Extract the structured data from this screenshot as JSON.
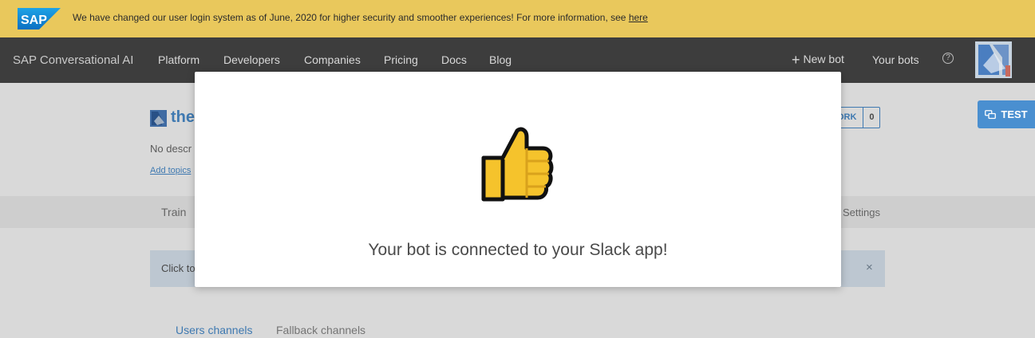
{
  "banner": {
    "logo_text": "SAP",
    "message": "We have changed our user login system as of June, 2020 for higher security and smoother experiences! For more information, see ",
    "link_label": "here"
  },
  "navbar": {
    "brand": "SAP Conversational AI",
    "items": [
      "Platform",
      "Developers",
      "Companies",
      "Pricing",
      "Docs",
      "Blog"
    ],
    "new_bot": "New bot",
    "your_bots": "Your bots",
    "help_symbol": "?"
  },
  "bot": {
    "name": "the",
    "description": "No descr",
    "add_topics": "Add topics",
    "fork_label": "ORK",
    "fork_count": "0"
  },
  "tabs": {
    "train": "Train",
    "settings": "Settings"
  },
  "info_bar": {
    "text": "Click to",
    "close_symbol": "×"
  },
  "channels": {
    "users": "Users channels",
    "fallback": "Fallback channels"
  },
  "test_button": {
    "label": "TEST"
  },
  "modal": {
    "icon": "thumbs-up-icon",
    "message": "Your bot is connected to your Slack app!"
  },
  "colors": {
    "banner": "#e9c85c",
    "navbar": "#3d3d3d",
    "accent": "#4a8fd0",
    "thumb_fill": "#f5c32c"
  }
}
